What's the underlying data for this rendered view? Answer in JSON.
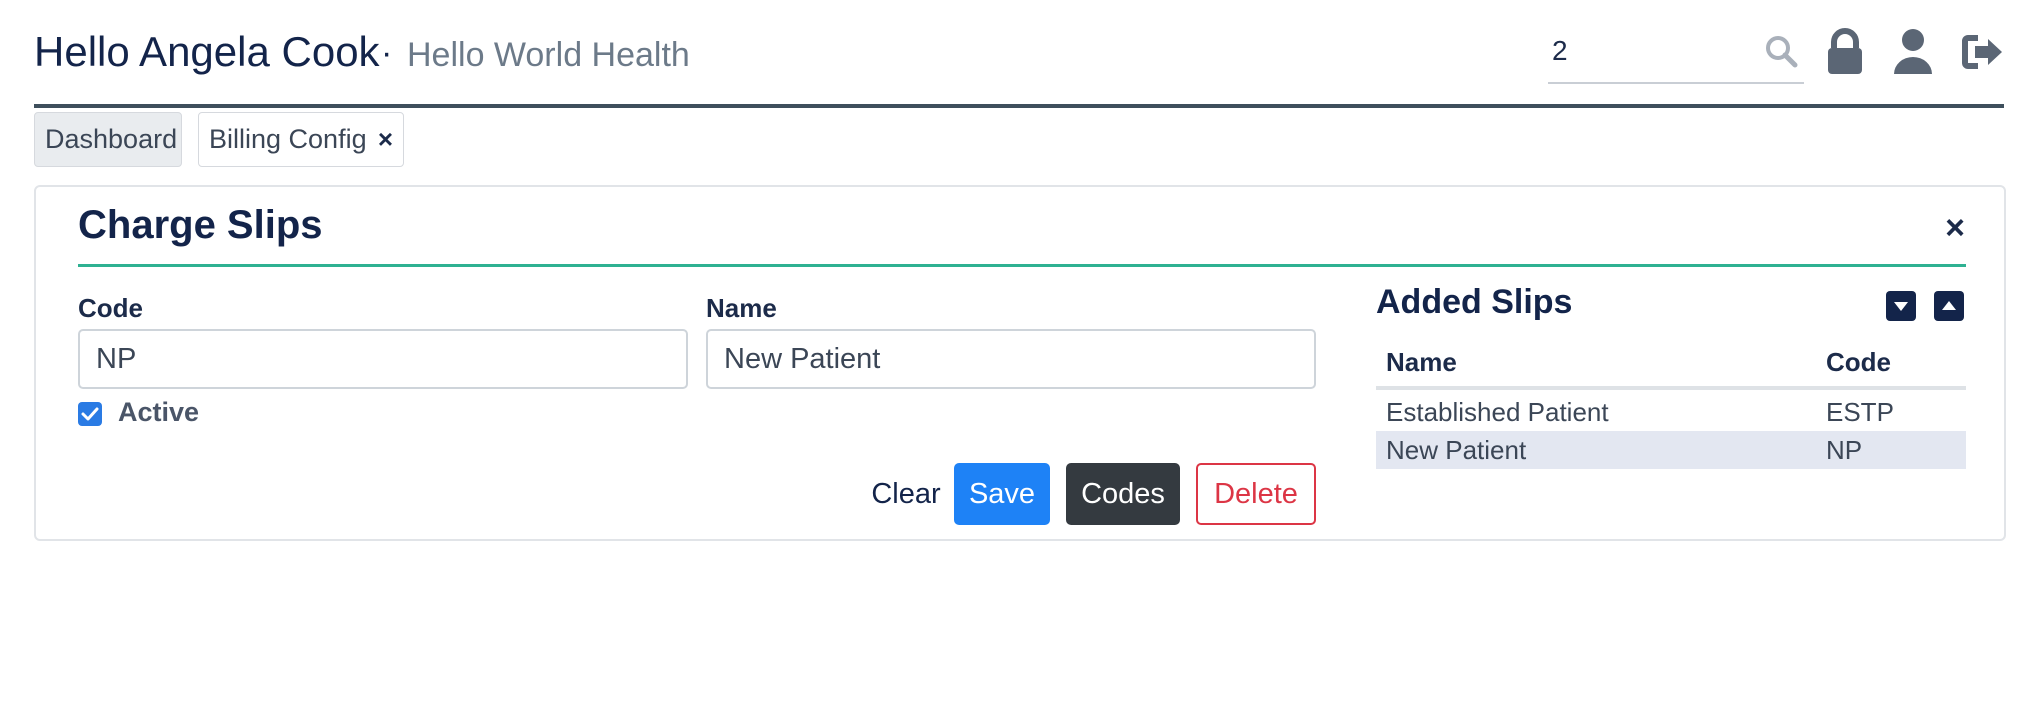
{
  "header": {
    "greeting": "Hello Angela Cook",
    "separator": "·",
    "org_name": "Hello World Health",
    "search_value": "2",
    "icons": [
      "search-icon",
      "lock-icon",
      "user-icon",
      "sign-out-icon"
    ]
  },
  "tabs": [
    {
      "label": "Dashboard",
      "active": false
    },
    {
      "label": "Billing Config",
      "active": true,
      "closable": true
    }
  ],
  "panel": {
    "title": "Charge Slips",
    "form": {
      "code_label": "Code",
      "code_value": "NP",
      "name_label": "Name",
      "name_value": "New Patient",
      "active_label": "Active",
      "active_checked": true
    },
    "buttons": {
      "clear": "Clear",
      "save": "Save",
      "codes": "Codes",
      "delete": "Delete"
    },
    "added_slips": {
      "title": "Added Slips",
      "columns": [
        "Name",
        "Code"
      ],
      "rows": [
        {
          "name": "Established Patient",
          "code": "ESTP",
          "selected": false
        },
        {
          "name": "New Patient",
          "code": "NP",
          "selected": true
        }
      ]
    }
  },
  "colors": {
    "accent_teal": "#2fb192",
    "primary_blue": "#1e82f6",
    "dark_navy": "#13244a",
    "danger_red": "#dc3545",
    "selected_row": "#e3e7f1"
  }
}
